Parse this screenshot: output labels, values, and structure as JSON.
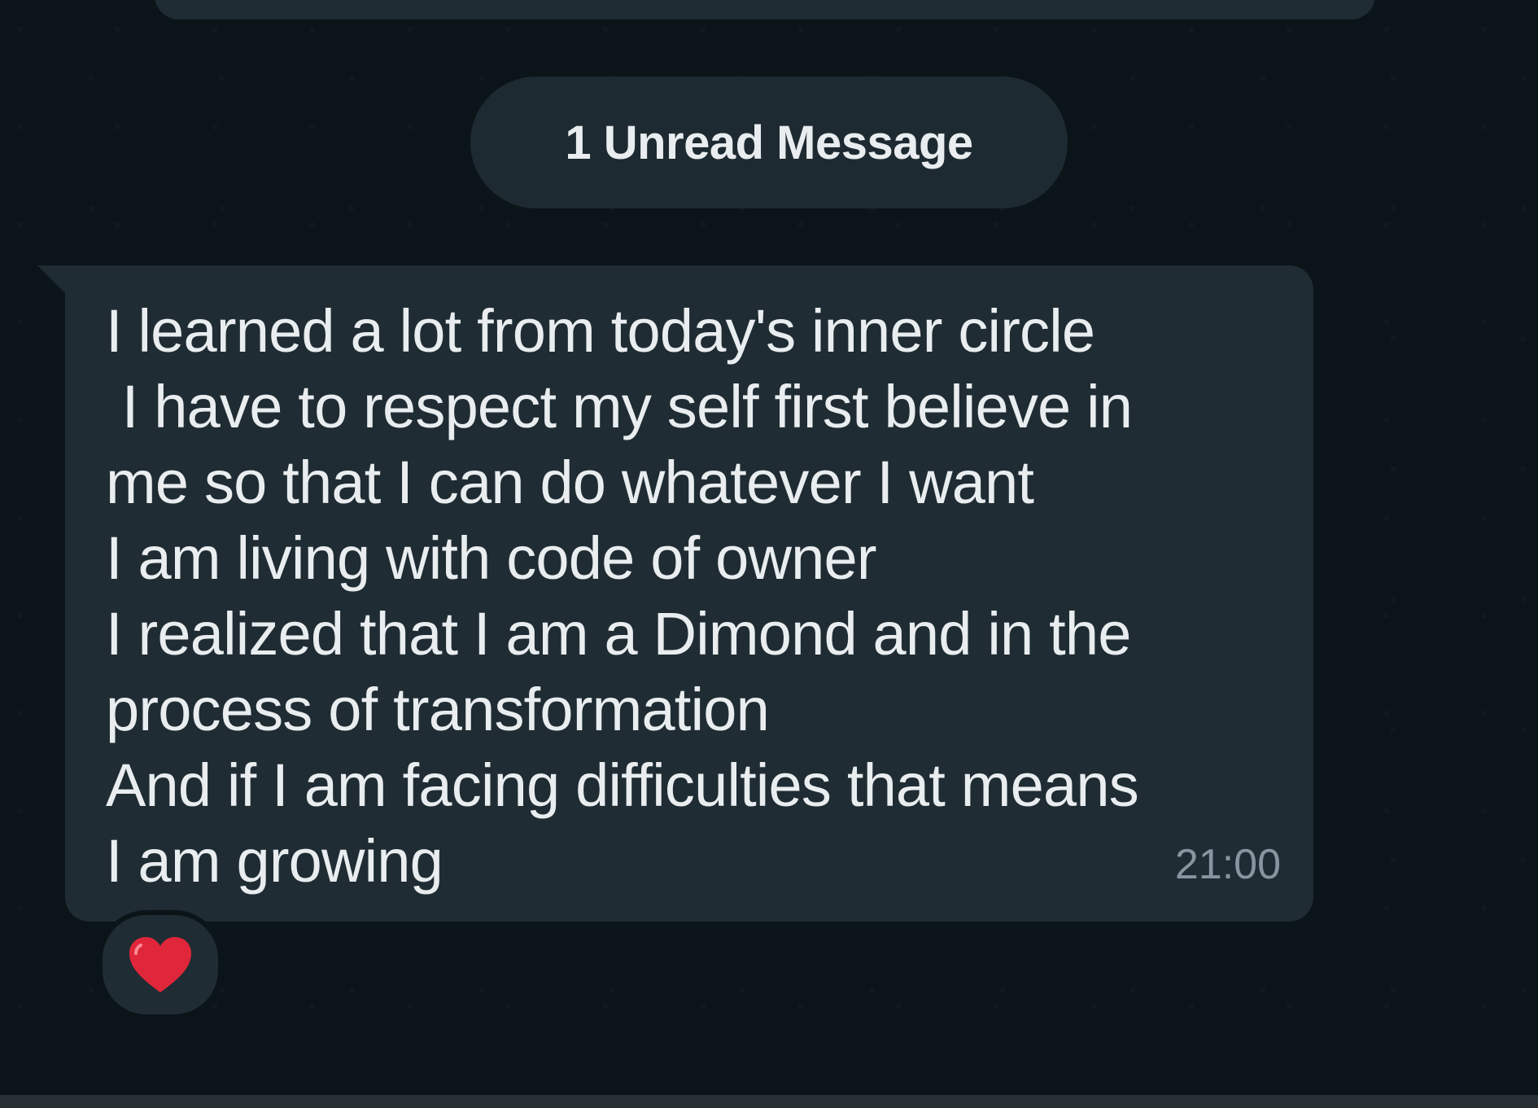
{
  "divider": {
    "unread_label": "1 Unread Message"
  },
  "message": {
    "lines": [
      "I learned a lot from today's inner circle",
      " I have to respect my self first believe in",
      "me so that I can do whatever I want",
      "I am living with code of owner",
      "I realized that I am a Dimond and in the",
      "process of transformation",
      "And if I am facing difficulties that means",
      "I am growing"
    ],
    "time": "21:00",
    "reaction_icon": "red-heart-icon"
  },
  "colors": {
    "background": "#0b1418",
    "bubble": "#1f2c33",
    "text": "#e9edef",
    "timestamp": "#8696a0",
    "heart": "#e0263a"
  }
}
